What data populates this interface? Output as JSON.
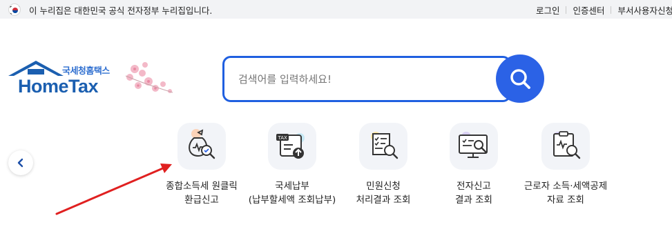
{
  "topbar": {
    "notice": "이 누리집은 대한민국 공식 전자정부 누리집입니다.",
    "links": [
      "로그인",
      "인증센터",
      "부서사용자신청"
    ]
  },
  "logo": {
    "sub": "국세청홈택스",
    "main": "HomeTax"
  },
  "search": {
    "placeholder": "검색어를 입력하세요!"
  },
  "quick_menu": [
    {
      "line1": "종합소득세 원클릭",
      "line2": "환급신고",
      "icon": "income-tax-refund-icon"
    },
    {
      "line1": "국세납부",
      "line2": "(납부할세액 조회납부)",
      "icon": "tax-payment-icon"
    },
    {
      "line1": "민원신청",
      "line2": "처리결과 조회",
      "icon": "civil-request-icon"
    },
    {
      "line1": "전자신고",
      "line2": "결과 조회",
      "icon": "e-filing-result-icon"
    },
    {
      "line1": "근로자 소득·세액공제",
      "line2": "자료 조회",
      "icon": "deduction-data-icon"
    }
  ],
  "colors": {
    "brand": "#1b5fb0",
    "search_border": "#1f5fe0",
    "search_button": "#2b62e6",
    "annotation_arrow": "#e02020"
  }
}
